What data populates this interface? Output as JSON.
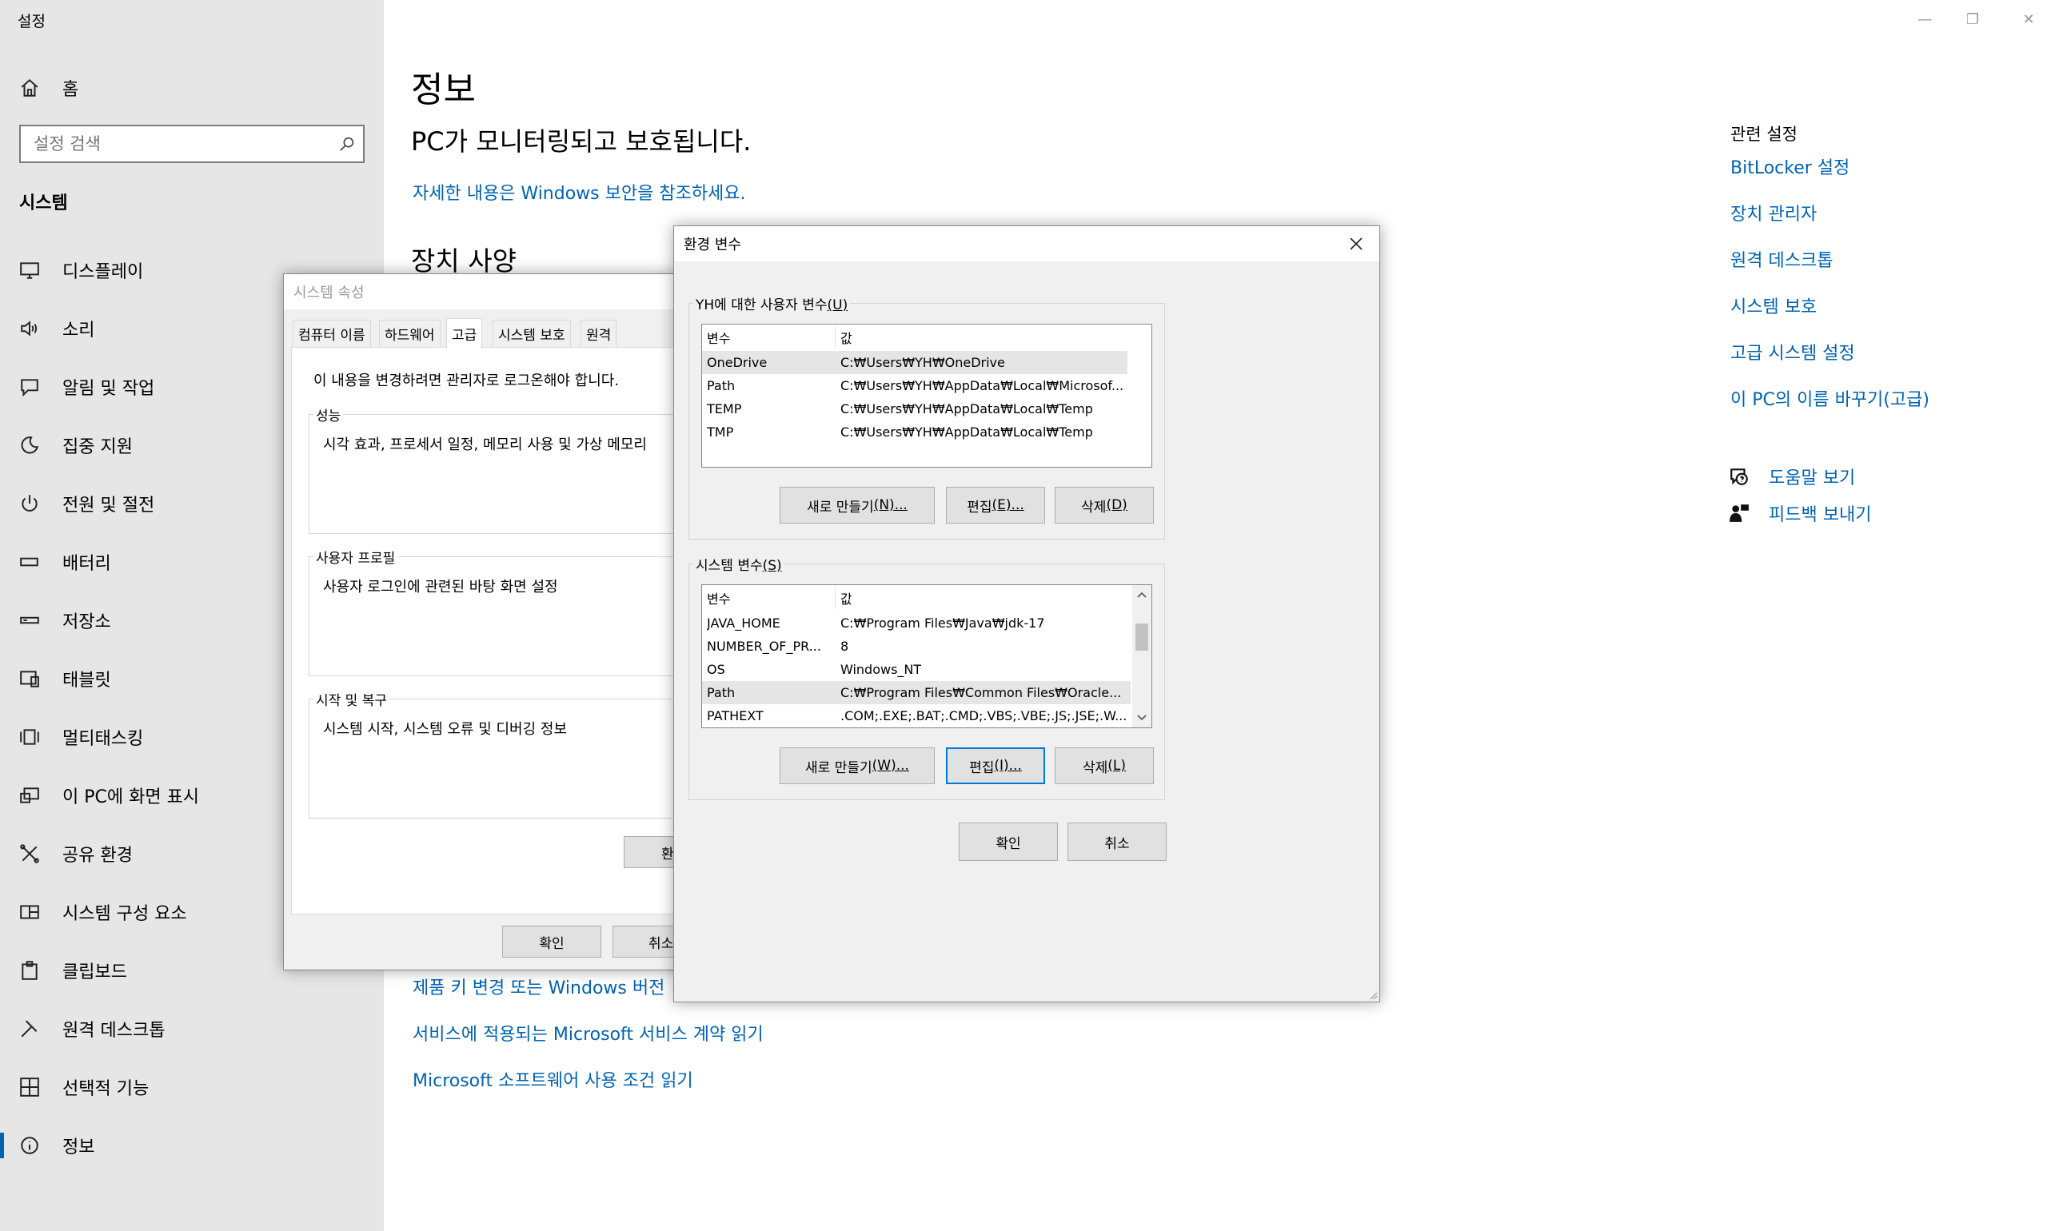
{
  "app": {
    "title": "설정"
  },
  "window_controls": {
    "minimize": "—",
    "maximize": "❐",
    "close": "✕"
  },
  "sidebar": {
    "home_label": "홈",
    "search_placeholder": "설정 검색",
    "section_title": "시스템",
    "items": [
      {
        "label": "디스플레이",
        "icon": "monitor-icon"
      },
      {
        "label": "소리",
        "icon": "speaker-icon"
      },
      {
        "label": "알림 및 작업",
        "icon": "notification-icon"
      },
      {
        "label": "집중 지원",
        "icon": "moon-icon"
      },
      {
        "label": "전원 및 절전",
        "icon": "power-icon"
      },
      {
        "label": "배터리",
        "icon": "battery-icon"
      },
      {
        "label": "저장소",
        "icon": "storage-icon"
      },
      {
        "label": "태블릿",
        "icon": "tablet-icon"
      },
      {
        "label": "멀티태스킹",
        "icon": "multitasking-icon"
      },
      {
        "label": "이 PC에 화면 표시",
        "icon": "project-icon"
      },
      {
        "label": "공유 환경",
        "icon": "share-icon"
      },
      {
        "label": "시스템 구성 요소",
        "icon": "components-icon"
      },
      {
        "label": "클립보드",
        "icon": "clipboard-icon"
      },
      {
        "label": "원격 데스크톱",
        "icon": "remote-icon"
      },
      {
        "label": "선택적 기능",
        "icon": "features-icon"
      },
      {
        "label": "정보",
        "icon": "info-icon",
        "active": true
      }
    ]
  },
  "main": {
    "title": "정보",
    "status": "PC가 모니터링되고 보호됩니다.",
    "security_link": "자세한 내용은 Windows 보안을 참조하세요.",
    "device_spec_title": "장치 사양",
    "links": [
      "제품 키 변경 또는 Windows 버전",
      "서비스에 적용되는 Microsoft 서비스 계약 읽기",
      "Microsoft 소프트웨어 사용 조건 읽기"
    ]
  },
  "related": {
    "title": "관련 설정",
    "links": [
      "BitLocker 설정",
      "장치 관리자",
      "원격 데스크톱",
      "시스템 보호",
      "고급 시스템 설정",
      "이 PC의 이름 바꾸기(고급)"
    ],
    "help": "도움말 보기",
    "feedback": "피드백 보내기"
  },
  "system_properties": {
    "title": "시스템 속성",
    "tabs": [
      "컴퓨터 이름",
      "하드웨어",
      "고급",
      "시스템 보호",
      "원격"
    ],
    "active_tab": "고급",
    "admin_note": "이 내용을 변경하려면 관리자로 로그온해야 합니다.",
    "performance": {
      "label": "성능",
      "desc": "시각 효과, 프로세서 일정, 메모리 사용 및 가상 메모리"
    },
    "user_profile": {
      "label": "사용자 프로필",
      "desc": "사용자 로그인에 관련된 바탕 화면 설정"
    },
    "startup": {
      "label": "시작 및 복구",
      "desc": "시스템 시작, 시스템 오류 및 디버깅 정보"
    },
    "env_button": "환",
    "ok": "확인",
    "cancel": "취소"
  },
  "env_vars": {
    "title": "환경 변수",
    "user_section": {
      "label": "YH에 대한 사용자 변수",
      "accel": "(U)"
    },
    "columns": {
      "var": "변수",
      "value": "값"
    },
    "user_vars": [
      {
        "name": "OneDrive",
        "value": "C:₩Users₩YH₩OneDrive"
      },
      {
        "name": "Path",
        "value": "C:₩Users₩YH₩AppData₩Local₩Microsof..."
      },
      {
        "name": "TEMP",
        "value": "C:₩Users₩YH₩AppData₩Local₩Temp"
      },
      {
        "name": "TMP",
        "value": "C:₩Users₩YH₩AppData₩Local₩Temp"
      }
    ],
    "user_buttons": {
      "new": "새로 만들기",
      "new_accel": "(N)...",
      "edit": "편집",
      "edit_accel": "(E)...",
      "delete": "삭제",
      "delete_accel": "(D)"
    },
    "system_section": {
      "label": "시스템 변수",
      "accel": "(S)"
    },
    "system_vars": [
      {
        "name": "JAVA_HOME",
        "value": "C:₩Program Files₩Java₩jdk-17"
      },
      {
        "name": "NUMBER_OF_PR...",
        "value": "8"
      },
      {
        "name": "OS",
        "value": "Windows_NT"
      },
      {
        "name": "Path",
        "value": "C:₩Program Files₩Common Files₩Oracle..."
      },
      {
        "name": "PATHEXT",
        "value": ".COM;.EXE;.BAT;.CMD;.VBS;.VBE;.JS;.JSE;.W..."
      }
    ],
    "system_buttons": {
      "new": "새로 만들기",
      "new_accel": "(W)...",
      "edit": "편집",
      "edit_accel": "(I)...",
      "delete": "삭제",
      "delete_accel": "(L)"
    },
    "ok": "확인",
    "cancel": "취소"
  }
}
